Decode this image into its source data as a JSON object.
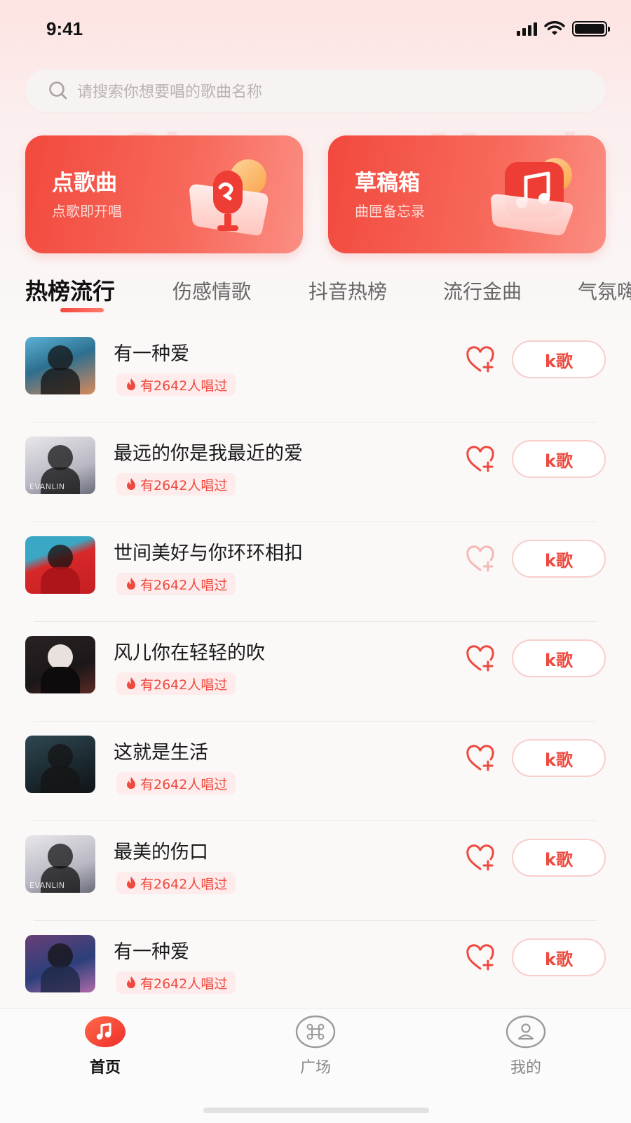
{
  "status_bar": {
    "time": "9:41"
  },
  "search": {
    "placeholder": "请搜索你想要唱的歌曲名称"
  },
  "watermarks": [
    "Sing",
    "Musi"
  ],
  "cards": [
    {
      "title": "点歌曲",
      "subtitle": "点歌即开唱",
      "icon": "microphone-icon"
    },
    {
      "title": "草稿箱",
      "subtitle": "曲匣备忘录",
      "icon": "music-note-icon"
    }
  ],
  "tabs": [
    {
      "label": "热榜流行",
      "active": true
    },
    {
      "label": "伤感情歌",
      "active": false
    },
    {
      "label": "抖音热榜",
      "active": false
    },
    {
      "label": "流行金曲",
      "active": false
    },
    {
      "label": "气氛嗨",
      "active": false
    }
  ],
  "songs": [
    {
      "title": "有一种爱",
      "sung": "有2642人唱过",
      "favorited": false,
      "button": "k歌"
    },
    {
      "title": "最远的你是我最近的爱",
      "sung": "有2642人唱过",
      "favorited": false,
      "button": "k歌",
      "cover_text": "EVANLIN"
    },
    {
      "title": "世间美好与你环环相扣",
      "sung": "有2642人唱过",
      "favorited": false,
      "button": "k歌"
    },
    {
      "title": "风儿你在轻轻的吹",
      "sung": "有2642人唱过",
      "favorited": false,
      "button": "k歌"
    },
    {
      "title": "这就是生活",
      "sung": "有2642人唱过",
      "favorited": false,
      "button": "k歌"
    },
    {
      "title": "最美的伤口",
      "sung": "有2642人唱过",
      "favorited": false,
      "button": "k歌",
      "cover_text": "EVANLIN"
    },
    {
      "title": "有一种爱",
      "sung": "有2642人唱过",
      "favorited": false,
      "button": "k歌"
    }
  ],
  "bottom_nav": [
    {
      "label": "首页",
      "icon": "music-note-icon",
      "active": true
    },
    {
      "label": "广场",
      "icon": "command-icon",
      "active": false
    },
    {
      "label": "我的",
      "icon": "user-icon",
      "active": false
    }
  ],
  "colors": {
    "accent": "#ee4a3f",
    "card_start": "#f2493d",
    "card_end": "#fb8e83"
  }
}
